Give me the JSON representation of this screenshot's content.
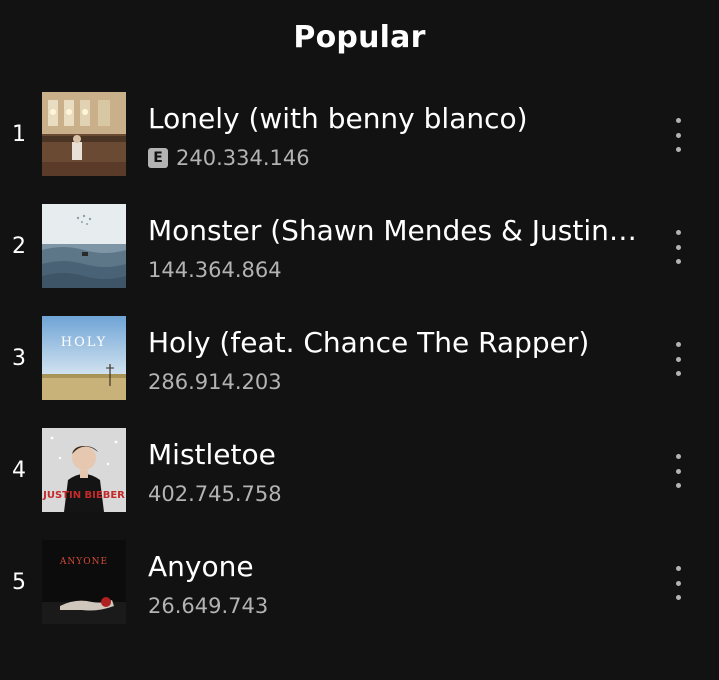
{
  "header": {
    "title": "Popular"
  },
  "tracks": [
    {
      "rank": "1",
      "title": "Lonely (with benny blanco)",
      "explicit": true,
      "explicit_label": "E",
      "plays": "240.334.146",
      "cover_icon": "lonely-album-cover"
    },
    {
      "rank": "2",
      "title": "Monster (Shawn Mendes & Justin Bieber)",
      "explicit": false,
      "plays": "144.364.864",
      "cover_icon": "monster-album-cover"
    },
    {
      "rank": "3",
      "title": "Holy (feat. Chance The Rapper)",
      "explicit": false,
      "plays": "286.914.203",
      "cover_icon": "holy-album-cover",
      "cover_text": "HOLY"
    },
    {
      "rank": "4",
      "title": "Mistletoe",
      "explicit": false,
      "plays": "402.745.758",
      "cover_icon": "mistletoe-album-cover",
      "cover_text": "JUSTIN BIEBER"
    },
    {
      "rank": "5",
      "title": "Anyone",
      "explicit": false,
      "plays": "26.649.743",
      "cover_icon": "anyone-album-cover",
      "cover_text": "ANYONE"
    }
  ],
  "colors": {
    "background": "#121212",
    "primary_text": "#ffffff",
    "secondary_text": "#b3b3b3"
  }
}
